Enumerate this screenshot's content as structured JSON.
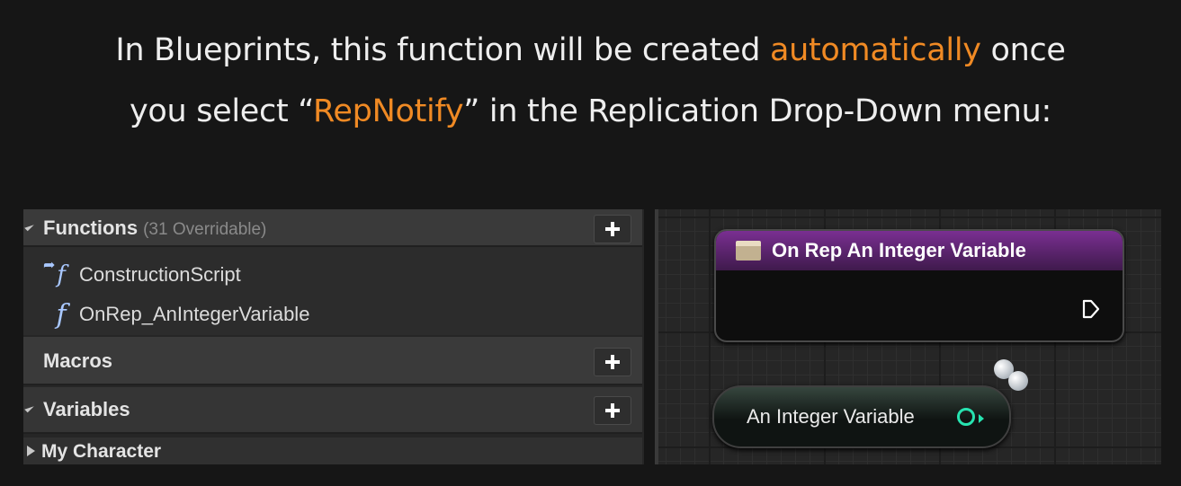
{
  "headline": {
    "line1_pre": "In Blueprints, this function will be created ",
    "line1_highlight": "automatically",
    "line1_post": " once",
    "line2_pre": "you select “",
    "line2_highlight": "RepNotify",
    "line2_post": "” in the Replication Drop-Down menu:"
  },
  "colors": {
    "highlight": "#f08a24",
    "background": "#161616",
    "node_header": "#7a2f92",
    "integer_pin": "#27e3b0"
  },
  "my_blueprint": {
    "functions": {
      "label": "Functions",
      "overridable": "(31 Overridable)",
      "items": [
        {
          "label": "ConstructionScript",
          "icon": "function-override-icon"
        },
        {
          "label": "OnRep_AnIntegerVariable",
          "icon": "function-icon"
        }
      ]
    },
    "macros": {
      "label": "Macros"
    },
    "variables": {
      "label": "Variables"
    },
    "my_character": {
      "label": "My Character"
    }
  },
  "graph": {
    "event_node": {
      "title": "On Rep An Integer Variable",
      "icon": "function-entry-icon"
    },
    "variable_node": {
      "label": "An Integer Variable",
      "icon": "integer-pin-icon"
    }
  }
}
